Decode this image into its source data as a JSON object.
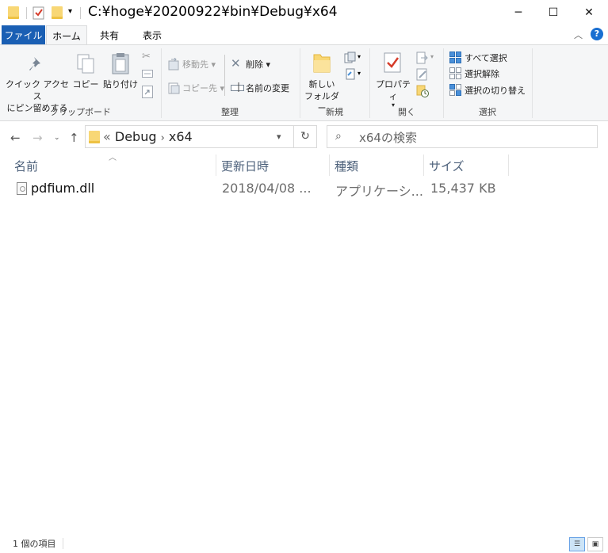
{
  "window": {
    "title": "C:¥hoge¥20200922¥bin¥Debug¥x64",
    "minimize_glyph": "─",
    "maximize_glyph": "☐",
    "close_glyph": "✕"
  },
  "tabs": {
    "file": "ファイル",
    "home": "ホーム",
    "share": "共有",
    "view": "表示"
  },
  "ribbon": {
    "clipboard": {
      "pin_label_1": "クイック アクセス",
      "pin_label_2": "にピン留めする",
      "copy": "コピー",
      "paste": "貼り付け",
      "group": "クリップボード"
    },
    "organize": {
      "move_to": "移動先",
      "copy_to": "コピー先",
      "delete": "削除",
      "rename": "名前の変更",
      "group": "整理"
    },
    "new": {
      "new_folder_1": "新しい",
      "new_folder_2": "フォルダー",
      "group": "新規"
    },
    "open": {
      "properties": "プロパティ",
      "group": "開く"
    },
    "select": {
      "select_all": "すべて選択",
      "select_none": "選択解除",
      "invert_selection": "選択の切り替え",
      "group": "選択"
    }
  },
  "address": {
    "overflow": "«",
    "crumb_1": "Debug",
    "separator": "›",
    "crumb_2": "x64"
  },
  "search": {
    "placeholder": "x64の検索"
  },
  "columns": {
    "name": "名前",
    "modified": "更新日時",
    "type": "種類",
    "size": "サイズ"
  },
  "files": [
    {
      "name": "pdfium.dll",
      "modified": "2018/04/08 ...",
      "type": "アプリケーシ...",
      "size": "15,437 KB"
    }
  ],
  "status": {
    "item_count": "1 個の項目"
  },
  "colors": {
    "accent": "#1a5fb4",
    "ribbon_bg": "#f5f6f7",
    "header_text": "#4c607a"
  }
}
